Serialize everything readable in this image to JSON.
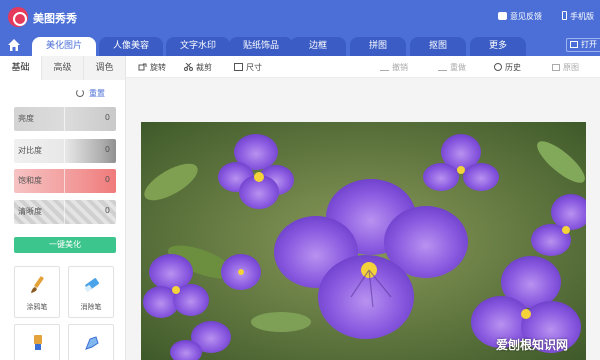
{
  "app": {
    "name": "美图秀秀"
  },
  "header": {
    "feedback_label": "意见反馈",
    "mobile_label": "手机版"
  },
  "nav": {
    "tabs": [
      {
        "label": "美化图片"
      },
      {
        "label": "人像美容"
      },
      {
        "label": "文字水印"
      },
      {
        "label": "贴纸饰品"
      },
      {
        "label": "边框"
      },
      {
        "label": "拼图"
      },
      {
        "label": "抠图"
      },
      {
        "label": "更多"
      }
    ],
    "active_tab": "美化图片",
    "open_label": "打开"
  },
  "panel": {
    "subtabs": [
      {
        "label": "基础"
      },
      {
        "label": "高级"
      },
      {
        "label": "调色"
      }
    ],
    "reset_label": "重置",
    "sliders": [
      {
        "label": "亮度",
        "value": "0"
      },
      {
        "label": "对比度",
        "value": "0"
      },
      {
        "label": "饱和度",
        "value": "0"
      },
      {
        "label": "清晰度",
        "value": "0"
      }
    ],
    "one_key_label": "一键美化",
    "tools": [
      {
        "label": "涂鸦笔"
      },
      {
        "label": "消除笔"
      }
    ]
  },
  "toolbar": {
    "rotate": "旋转",
    "crop": "裁剪",
    "size": "尺寸",
    "undo": "撤销",
    "redo": "重做",
    "history": "历史",
    "original": "原图"
  },
  "watermark": "爱刨根知识网",
  "colors": {
    "header": "#4b6fd6",
    "active_button": "#3cc58c",
    "saturation": "#f07a7a"
  }
}
